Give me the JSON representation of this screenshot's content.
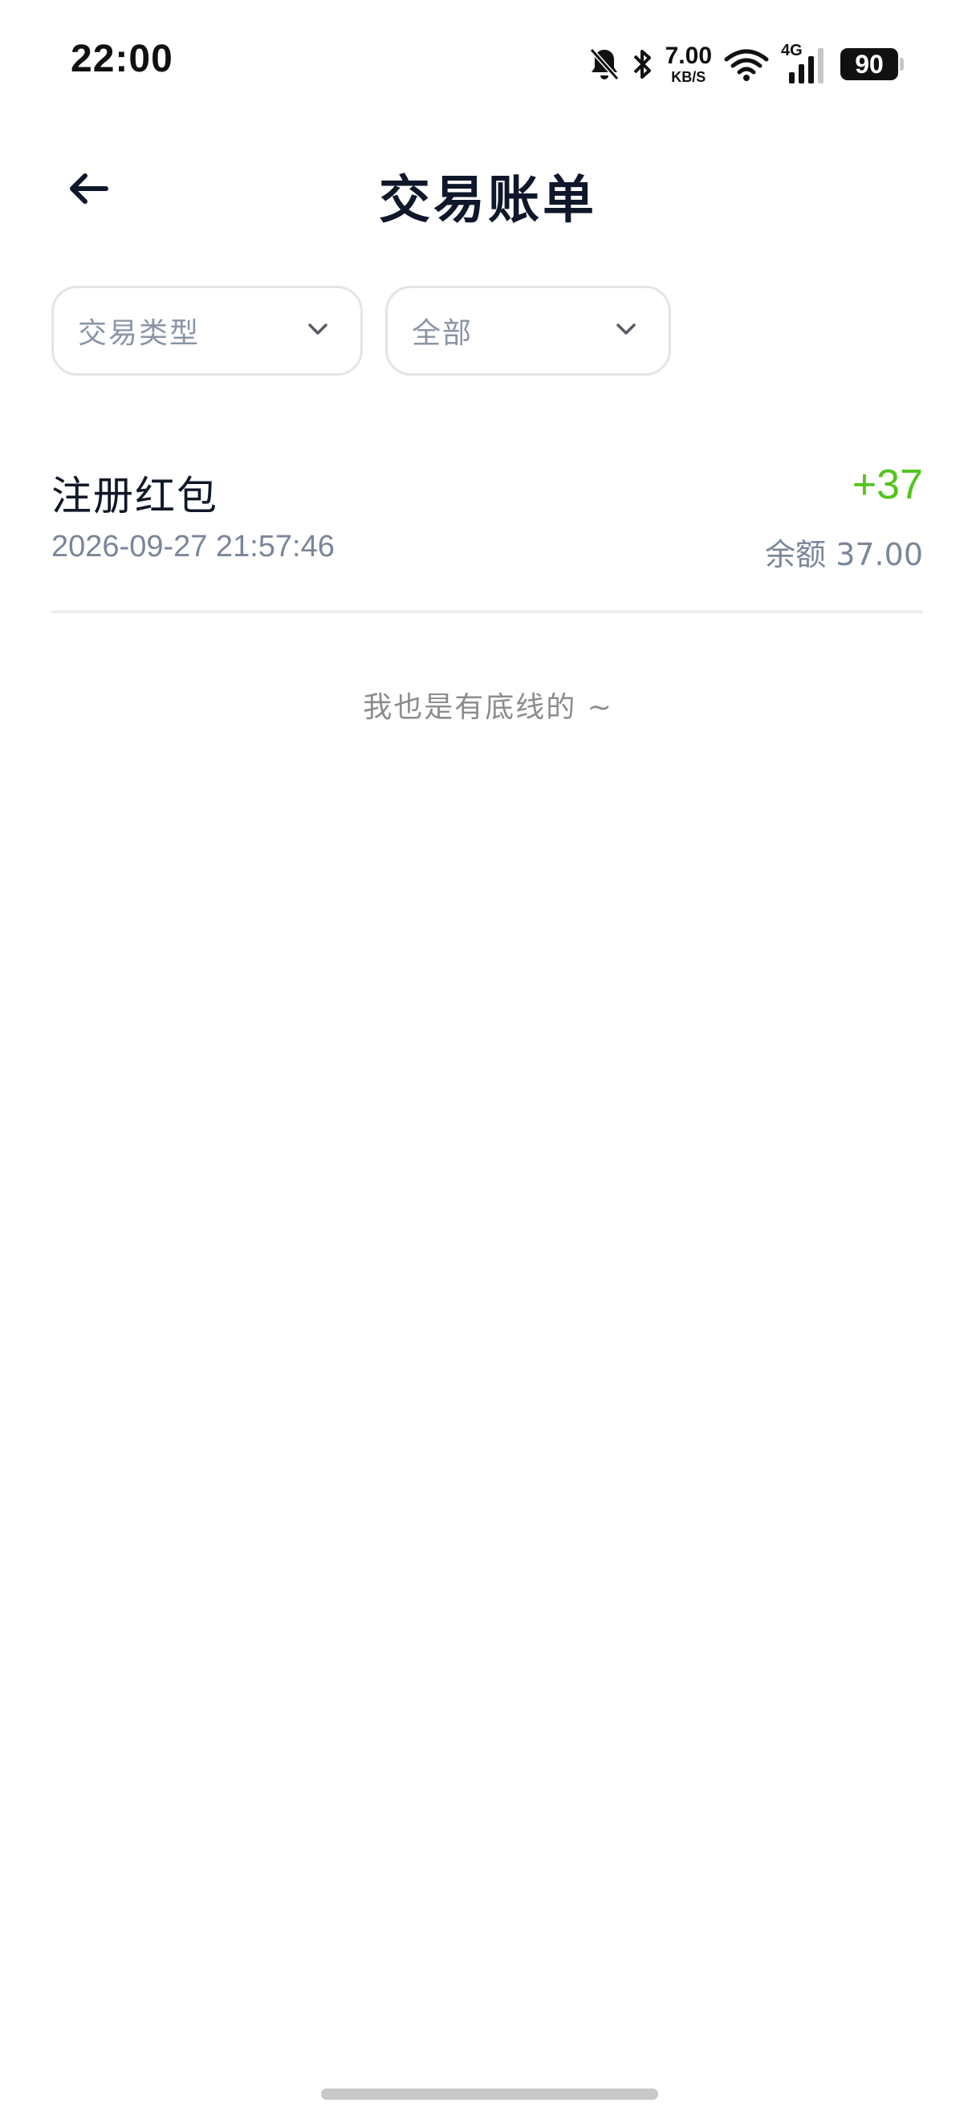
{
  "status_bar": {
    "time": "22:00",
    "net_speed_value": "7.00",
    "net_speed_unit": "KB/S",
    "network_type": "4G",
    "battery_level": "90",
    "icons": [
      "bell-muted-icon",
      "bluetooth-icon",
      "wifi-icon",
      "cellular-signal-icon",
      "battery-icon"
    ]
  },
  "header": {
    "title": "交易账单",
    "back_icon": "arrow-left-icon"
  },
  "filters": {
    "type": {
      "label": "交易类型",
      "icon": "chevron-down-icon"
    },
    "range": {
      "label": "全部",
      "icon": "chevron-down-icon"
    }
  },
  "transactions": [
    {
      "name": "注册红包",
      "amount": "+37",
      "time": "2026-09-27 21:57:46",
      "balance": "余额 37.00"
    }
  ],
  "end_note": "我也是有底线的 ~",
  "colors": {
    "income": "#52c41a",
    "muted_text": "#7a8699",
    "border": "#e3e5e9"
  }
}
